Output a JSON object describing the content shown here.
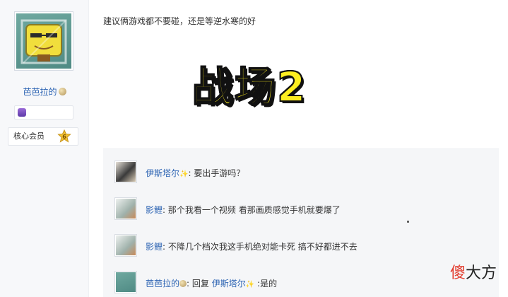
{
  "author": {
    "username": "芭芭拉的",
    "member_label": "核心会员",
    "member_level": "6"
  },
  "post": {
    "text": "建议俩游戏都不要碰，还是等逆水寒的好",
    "overlay_caption": "战场2"
  },
  "replies": [
    {
      "name": "伊斯塔尔",
      "sep": ":",
      "text": "要出手游吗？",
      "sparkle": true
    },
    {
      "name": "影鲤",
      "sep": ":",
      "text": "那个我看一个视频 看那画质感觉手机就要爆了",
      "sparkle": false
    },
    {
      "name": "影鲤",
      "sep": ":",
      "text": "不降几个档次我这手机绝对能卡死 搞不好都进不去",
      "sparkle": false
    },
    {
      "name": "芭芭拉的",
      "reply_word": "回复",
      "target": "伊斯塔尔",
      "sep": " :",
      "text": "是的"
    }
  ],
  "watermark": {
    "part1": "傻",
    "part2": "大方"
  },
  "colors": {
    "link_blue": "#2d64b3",
    "caption_yellow": "#fdee20",
    "watermark_red": "#e23a2c"
  }
}
